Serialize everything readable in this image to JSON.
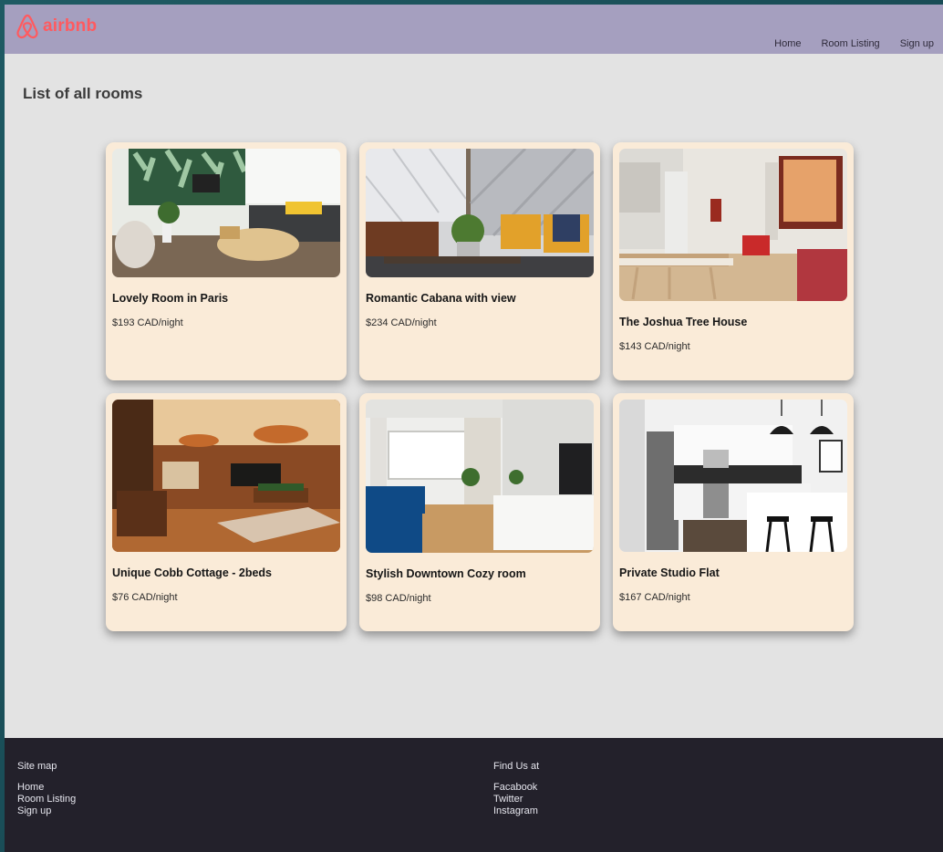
{
  "brand": {
    "name": "airbnb",
    "color": "#ff5a5f"
  },
  "nav": [
    "Home",
    "Room Listing",
    "Sign up"
  ],
  "page_title": "List of all rooms",
  "rooms": [
    {
      "title": "Lovely Room in Paris",
      "price": "$193 CAD/night",
      "photo_icon": "living-room-photo"
    },
    {
      "title": "Romantic Cabana with view",
      "price": "$234 CAD/night",
      "photo_icon": "lounge-photo"
    },
    {
      "title": "The Joshua Tree House",
      "price": "$143 CAD/night",
      "photo_icon": "kitchen-living-photo"
    },
    {
      "title": "Unique Cobb Cottage - 2beds",
      "price": "$76 CAD/night",
      "photo_icon": "billiard-room-photo"
    },
    {
      "title": "Stylish Downtown Cozy room",
      "price": "$98 CAD/night",
      "photo_icon": "modern-living-photo"
    },
    {
      "title": "Private Studio Flat",
      "price": "$167 CAD/night",
      "photo_icon": "studio-kitchen-photo"
    }
  ],
  "footer": {
    "sitemap": {
      "heading": "Site map",
      "links": [
        "Home",
        "Room Listing",
        "Sign up"
      ]
    },
    "findus": {
      "heading": "Find Us at",
      "links": [
        "Facabook",
        "Twitter",
        "Instagram"
      ]
    }
  }
}
